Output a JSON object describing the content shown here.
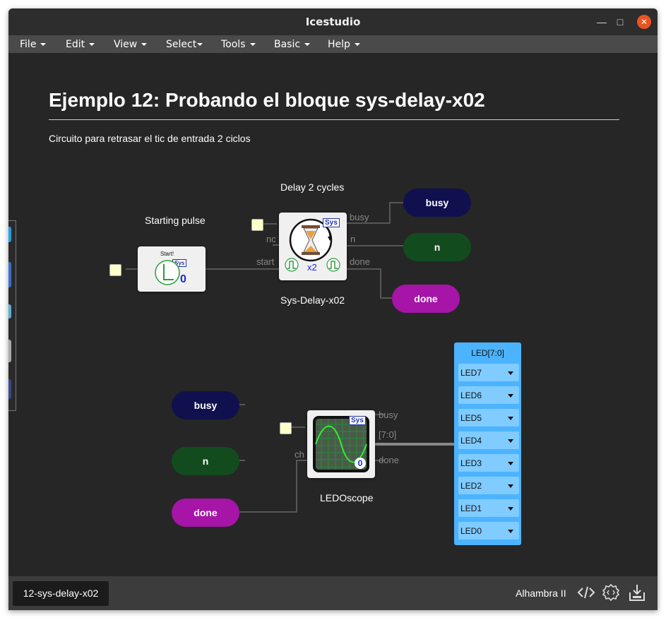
{
  "window": {
    "title": "Icestudio"
  },
  "menu": [
    {
      "label": "File"
    },
    {
      "label": "Edit"
    },
    {
      "label": "View"
    },
    {
      "label": "Select"
    },
    {
      "label": "Tools"
    },
    {
      "label": "Basic"
    },
    {
      "label": "Help"
    }
  ],
  "doc": {
    "heading": "Ejemplo 12: Probando el bloque sys-delay-x02",
    "description": "Circuito para retrasar el tic de entrada 2 ciclos"
  },
  "circuit": {
    "start_block": {
      "label": "Starting pulse",
      "badge_text": "Start!",
      "sys": "Sys",
      "value": "0"
    },
    "delay_block": {
      "top_label": "Delay 2 cycles",
      "bottom_label": "Sys-Delay-x02",
      "sys": "Sys",
      "multiplier": "x2",
      "ports": {
        "nc": "nc",
        "start": "start",
        "busy": "busy",
        "n": "n",
        "done": "done"
      }
    },
    "outputs": {
      "busy": "busy",
      "n": "n",
      "done": "done"
    },
    "inputs": {
      "busy": "busy",
      "n": "n",
      "done": "done"
    },
    "scope_block": {
      "label": "LEDOscope",
      "sys": "Sys",
      "value": "0",
      "ports": {
        "ch": "ch",
        "busy": "busy",
        "bus": "[7:0]",
        "done": "done"
      }
    },
    "led_panel": {
      "title": "LED[7:0]",
      "leds": [
        "LED7",
        "LED6",
        "LED5",
        "LED4",
        "LED3",
        "LED2",
        "LED1",
        "LED0"
      ]
    }
  },
  "status": {
    "file_tab": "12-sys-delay-x02",
    "board": "Alhambra II"
  },
  "icons": [
    "close-icon",
    "minimize-icon",
    "maximize-icon",
    "code-icon",
    "settings-icon",
    "upload-icon"
  ],
  "colors": {
    "busy": "#10104f",
    "n": "#124c1e",
    "done": "#a714a8",
    "led_panel": "#4cb3ff",
    "canvas": "#262626"
  }
}
